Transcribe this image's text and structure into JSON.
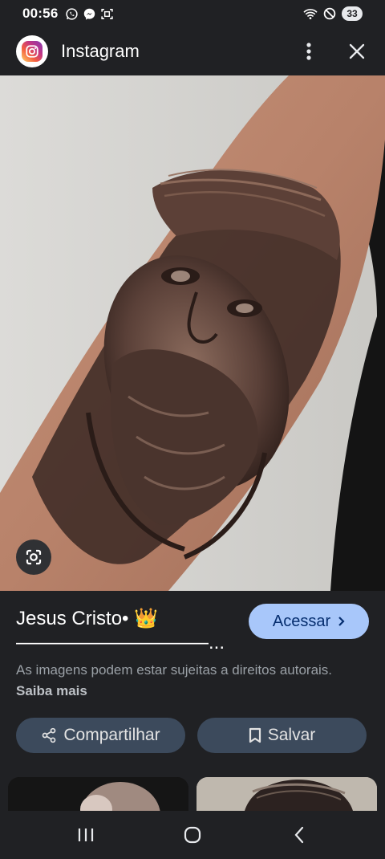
{
  "status_bar": {
    "time": "00:56",
    "left_icons": [
      "whatsapp-icon",
      "messenger-icon",
      "screenshot-icon"
    ],
    "right_icons": [
      "wifi-icon",
      "do-not-disturb-icon"
    ],
    "battery_level": "33"
  },
  "header": {
    "title": "Instagram",
    "icons": [
      "instagram-logo",
      "more-vert-icon",
      "close-icon"
    ]
  },
  "image": {
    "lens_icon": "google-lens-icon"
  },
  "result": {
    "title": "Jesus Cristo• 👑 ——————————...",
    "access_label": "Acessar",
    "access_icon": "chevron-right-icon",
    "copyright_text": "As imagens podem estar sujeitas a direitos autorais.",
    "learn_more": "Saiba mais",
    "share_label": "Compartilhar",
    "share_icon": "share-icon",
    "save_label": "Salvar",
    "save_icon": "bookmark-icon"
  },
  "colors": {
    "background": "#202124",
    "accent_button": "#a8c7fa",
    "pill_button": "#3c4a5c"
  },
  "nav_bar": {
    "icons": [
      "recent-apps-icon",
      "home-icon",
      "back-icon"
    ]
  }
}
